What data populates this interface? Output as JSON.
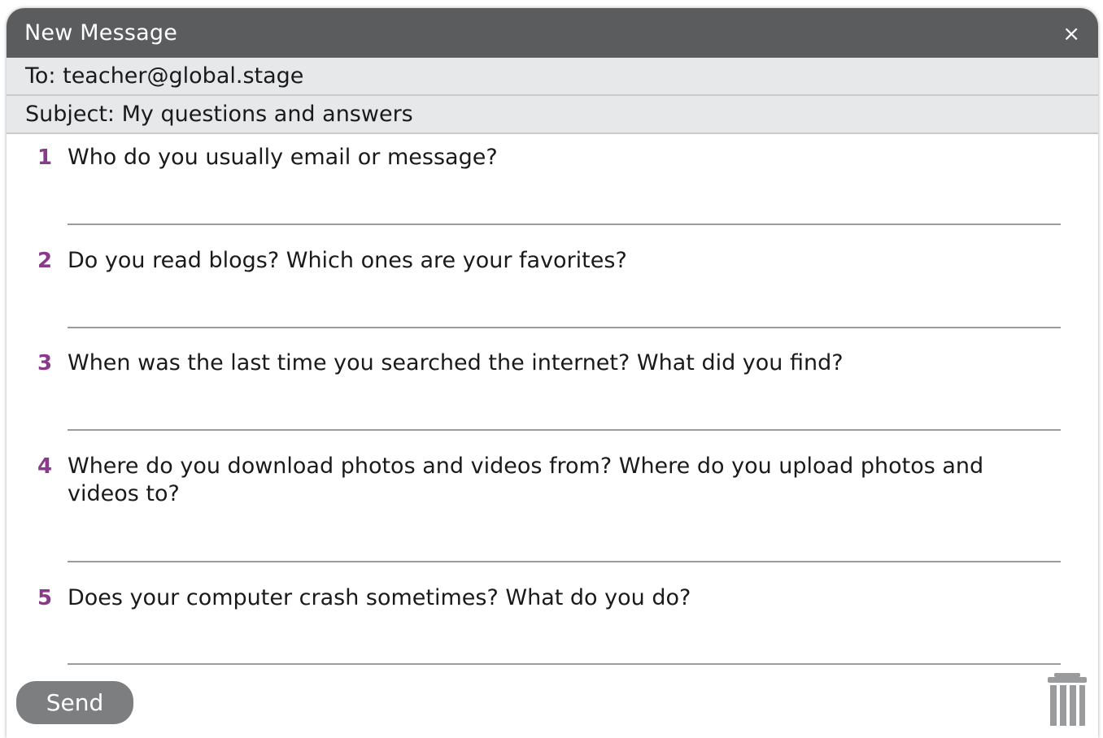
{
  "window": {
    "title": "New Message",
    "close_label": "×"
  },
  "header": {
    "to": "To: teacher@global.stage",
    "subject": "Subject: My questions and answers"
  },
  "questions": [
    {
      "number": "1",
      "text": "Who do you usually email or message?"
    },
    {
      "number": "2",
      "text": "Do you read blogs? Which ones are your favorites?"
    },
    {
      "number": "3",
      "text": "When was the last time you searched the internet? What did you find?"
    },
    {
      "number": "4",
      "text": "Where do you download photos and videos from? Where do you upload photos and videos to?"
    },
    {
      "number": "5",
      "text": "Does your computer crash sometimes? What do you do?"
    }
  ],
  "footer": {
    "send_label": "Send",
    "trash_icon": "trash-icon"
  },
  "colors": {
    "titlebar": "#5b5c5e",
    "number_accent": "#8a3a8a",
    "send_button": "#7d7e80"
  }
}
